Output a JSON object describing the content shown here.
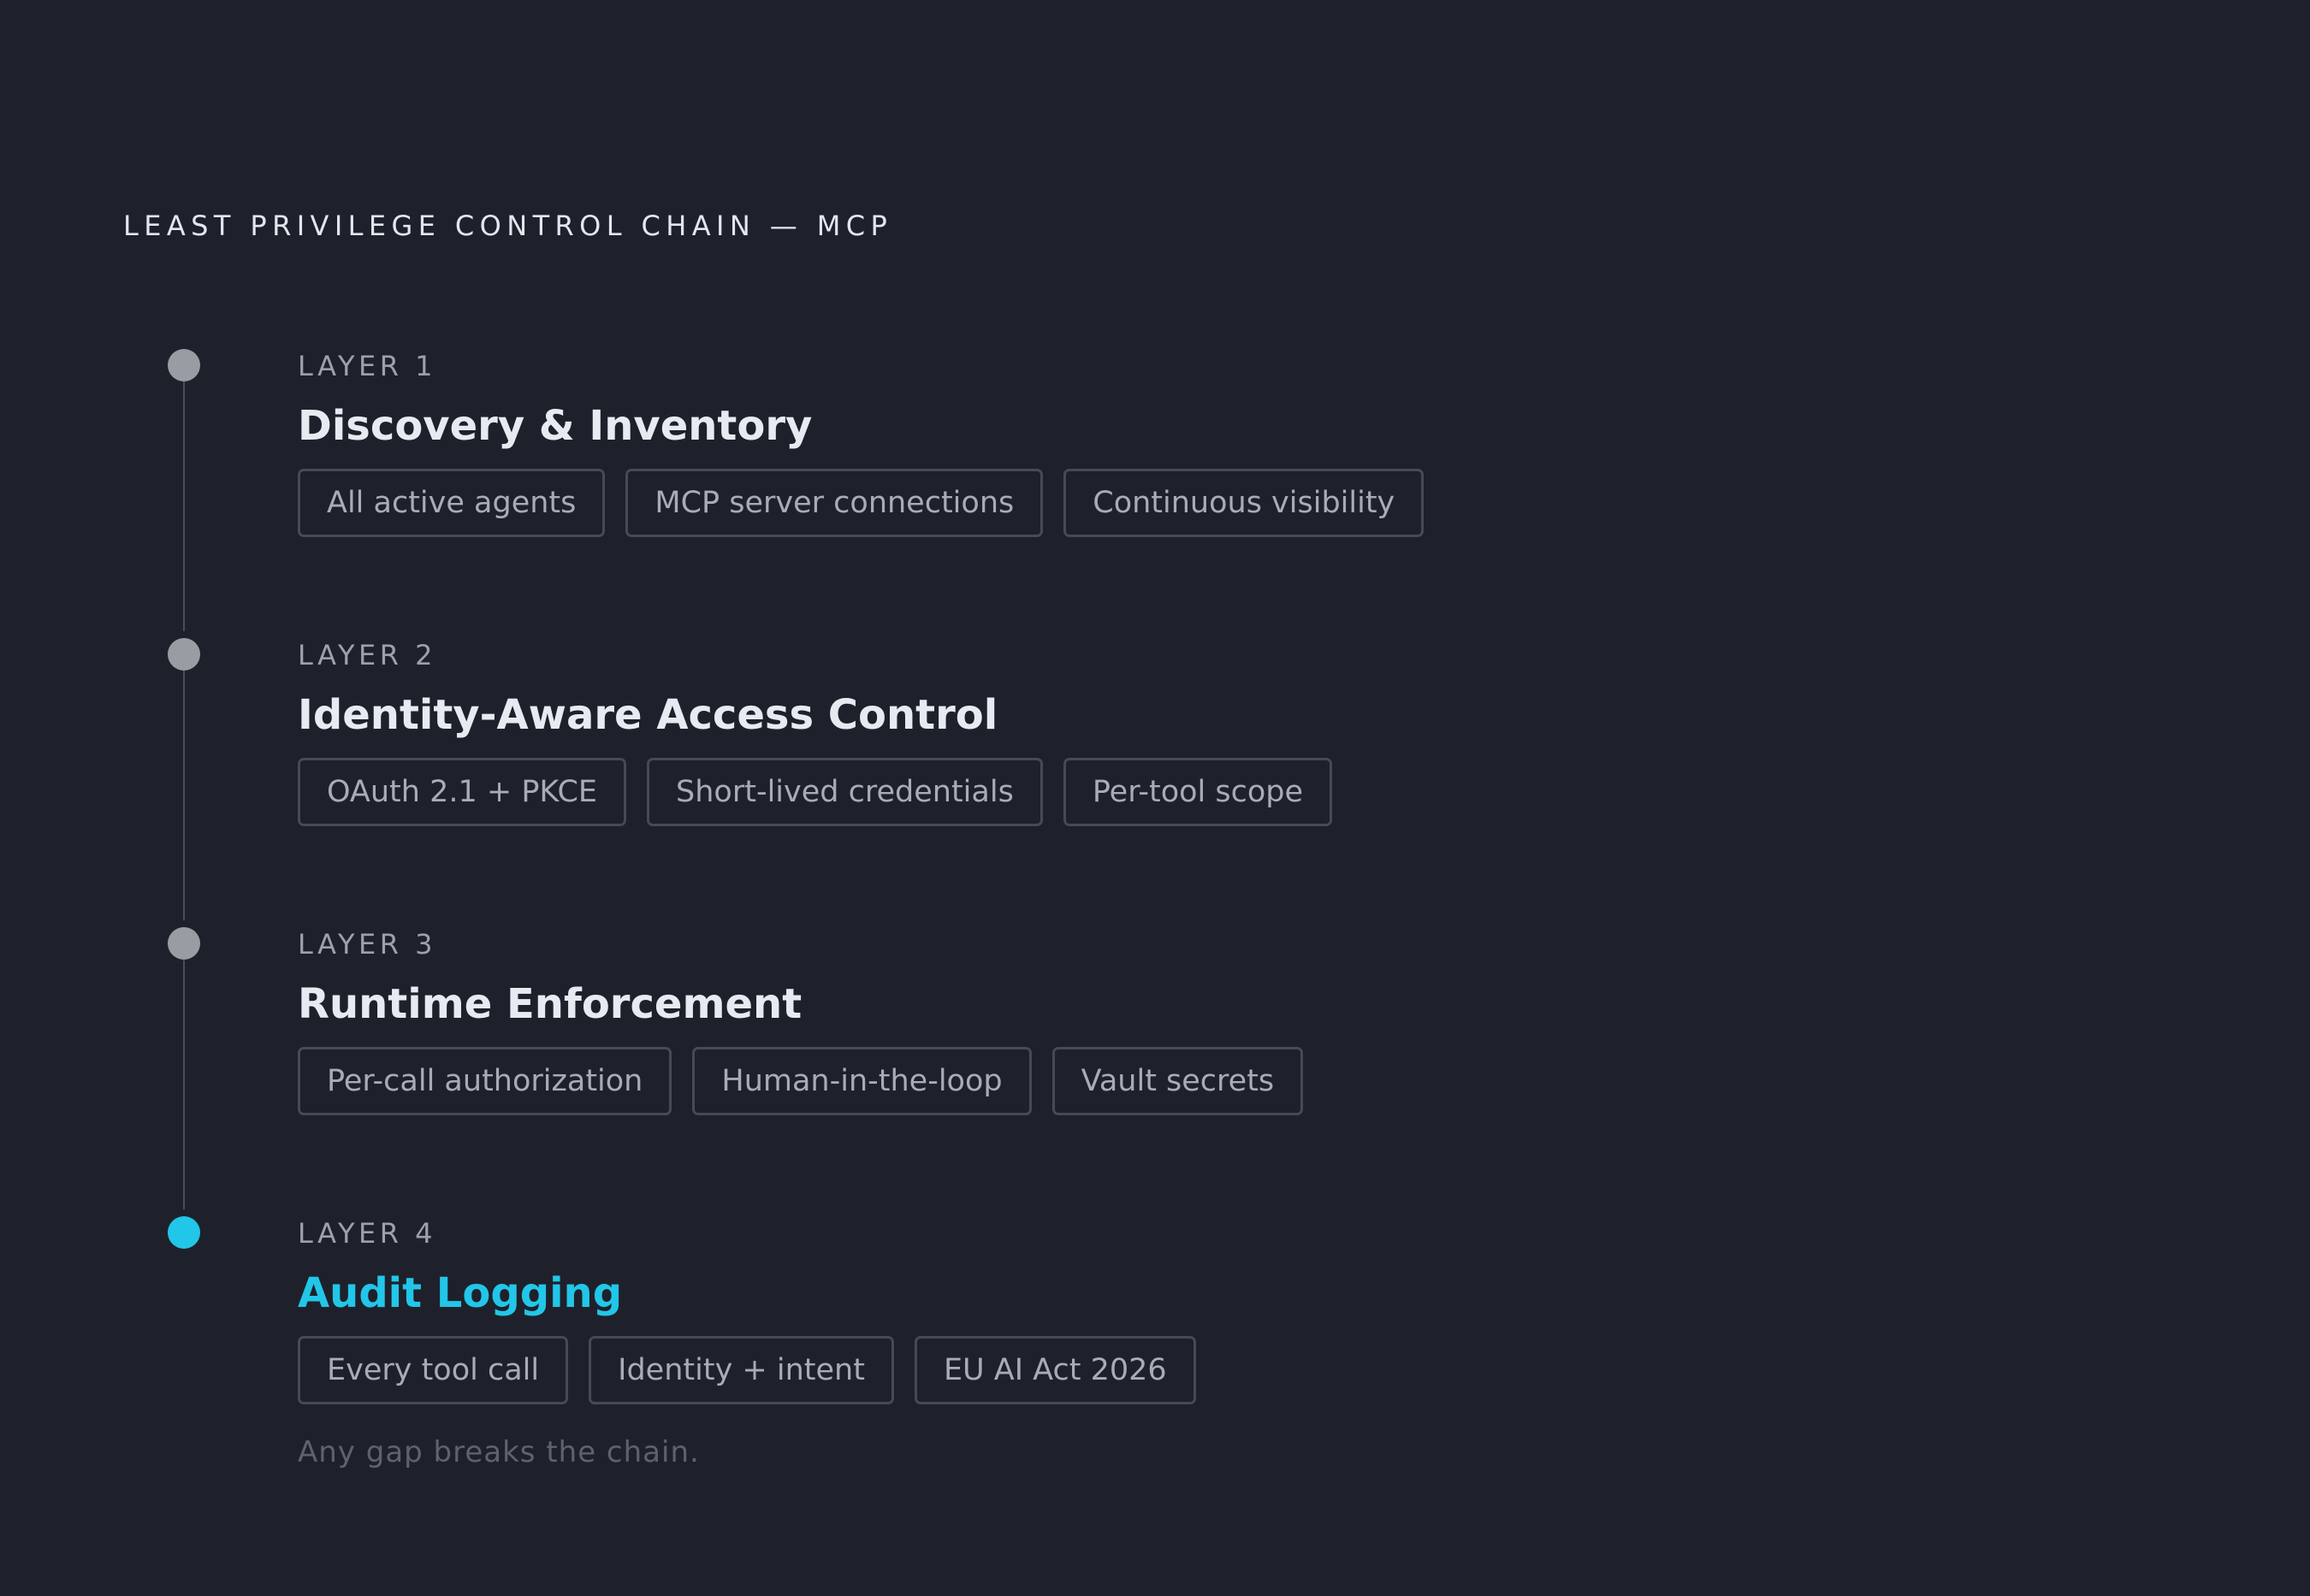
{
  "heading": "LEAST PRIVILEGE CONTROL CHAIN — MCP",
  "colors": {
    "background": "#1e212b",
    "inactive_dot": "#9a9ca4",
    "active_accent": "#22c6e8",
    "connector": "#4a4e59"
  },
  "layers": [
    {
      "label": "LAYER 1",
      "title": "Discovery & Inventory",
      "active": false,
      "tags": [
        "All active agents",
        "MCP server connections",
        "Continuous visibility"
      ]
    },
    {
      "label": "LAYER 2",
      "title": "Identity-Aware Access Control",
      "active": false,
      "tags": [
        "OAuth 2.1 + PKCE",
        "Short-lived credentials",
        "Per-tool scope"
      ]
    },
    {
      "label": "LAYER 3",
      "title": "Runtime Enforcement",
      "active": false,
      "tags": [
        "Per-call authorization",
        "Human-in-the-loop",
        "Vault secrets"
      ]
    },
    {
      "label": "LAYER 4",
      "title": "Audit Logging",
      "active": true,
      "tags": [
        "Every tool call",
        "Identity + intent",
        "EU AI Act 2026"
      ]
    }
  ],
  "footnote": "Any gap breaks the chain."
}
